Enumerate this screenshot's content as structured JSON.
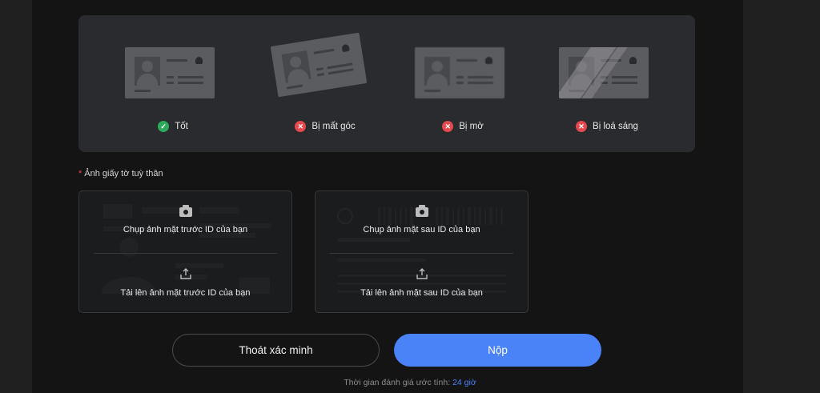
{
  "examples": [
    {
      "label": "Tốt",
      "status": "ok",
      "icon": "check-icon"
    },
    {
      "label": "Bị mất góc",
      "status": "bad",
      "icon": "x-icon"
    },
    {
      "label": "Bị mờ",
      "status": "bad",
      "icon": "x-icon"
    },
    {
      "label": "Bị loá sáng",
      "status": "bad",
      "icon": "x-icon"
    }
  ],
  "status_icons": {
    "ok": "✓",
    "bad": "✕"
  },
  "colors": {
    "ok": "#2eaa5c",
    "bad": "#e5484d",
    "accent": "#4a82f7"
  },
  "id_section": {
    "required_mark": "*",
    "label": "Ảnh giấy tờ tuỳ thân"
  },
  "front": {
    "capture_label": "Chụp ảnh mặt trước ID của bạn",
    "upload_label": "Tải lên ảnh mặt trước ID của bạn"
  },
  "back": {
    "capture_label": "Chụp ảnh mặt sau ID của bạn",
    "upload_label": "Tải lên ảnh mặt sau ID của bạn"
  },
  "buttons": {
    "exit_label": "Thoát xác minh",
    "submit_label": "Nộp"
  },
  "eta": {
    "prefix": "Thời gian đánh giá ước tính:",
    "value": "24 giờ"
  }
}
